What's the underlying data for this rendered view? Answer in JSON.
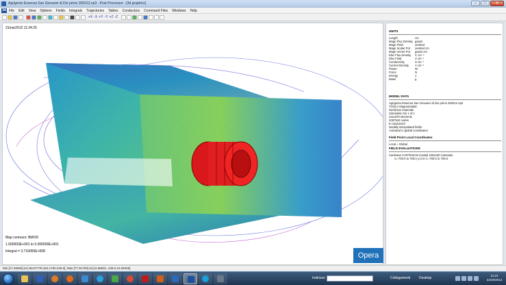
{
  "window": {
    "title": "Agrigento Essenza San Giovanni di Dio primo 300312.op3 - Post-Processor - [3d graphics]",
    "minimize": "–",
    "maximize": "□",
    "close": "✕"
  },
  "menu": {
    "logo": "3d",
    "items": [
      "File",
      "Edit",
      "View",
      "Options",
      "Fields",
      "Integrals",
      "Trajectories",
      "Tables",
      "Conductors",
      "Command Files",
      "Windows",
      "Help"
    ]
  },
  "toolbar": {
    "axis_labels": [
      "+X",
      "-X",
      "+Y",
      "-Y",
      "+Z",
      "-Z"
    ]
  },
  "viewport": {
    "date": "31mar2012 11:24:25",
    "map_contours": "Map contours: BMOD",
    "range": "1.000000E+001 to 5.000000E+001",
    "integral": "Integral = 3.716055E+008"
  },
  "badge": {
    "text": "Opera",
    "color": "#2071b8"
  },
  "panel": {
    "units": {
      "title": "UNITS",
      "rows": [
        {
          "k": "Length",
          "v": "cm"
        },
        {
          "k": "Magn Flux Density",
          "v": "gauss"
        },
        {
          "k": "Magn Field",
          "v": "oersted"
        },
        {
          "k": "Magn Scalar Pot",
          "v": "oersted cm"
        },
        {
          "k": "Magn Vector Pot",
          "v": "gauss cm"
        },
        {
          "k": "Elec Flux Density",
          "v": "C cm⁻²"
        },
        {
          "k": "Elec Field",
          "v": "V cm⁻¹"
        },
        {
          "k": "Conductivity",
          "v": "S cm⁻¹"
        },
        {
          "k": "Current Density",
          "v": "A cm⁻²"
        },
        {
          "k": "Power",
          "v": "W"
        },
        {
          "k": "Force",
          "v": "N"
        },
        {
          "k": "Energy",
          "v": "J"
        },
        {
          "k": "Mass",
          "v": "g"
        }
      ]
    },
    "model": {
      "title": "MODEL DATA",
      "lines": [
        "Agrigento Essenza San Giovanni di Dio primo 300312.op3",
        "TOSCA Magnetostatic",
        "Nonlinear materials",
        "Simulation No 1 of 1",
        "2111078 elements",
        "2067542 nodes",
        "8 conductors",
        "Nodally interpolated fields",
        "Activated in global coordinates"
      ]
    },
    "local": {
      "title": "Field Point Local Coordinates",
      "lines": [
        "Local = Global"
      ]
    },
    "evaluations": {
      "title": "FIELD EVALUATIONS",
      "lines": [
        "Cartesian CARTESIAN (nodal) 100x100 Cartesian",
        "x=-700.0 to 700.0  y=0.0  z=-700.0 to 700.0"
      ]
    }
  },
  "status": {
    "text": "Min [17.46583] at [-58.07778,162.1792,225.0], Max [77.91793] at [12.66831,-139.0,10.84026]"
  },
  "taskbar": {
    "address_label": "Indirizzo",
    "links_label": "Collegamenti",
    "desktop_label": "Desktop",
    "time": "11:24",
    "date": "31/03/2012"
  }
}
